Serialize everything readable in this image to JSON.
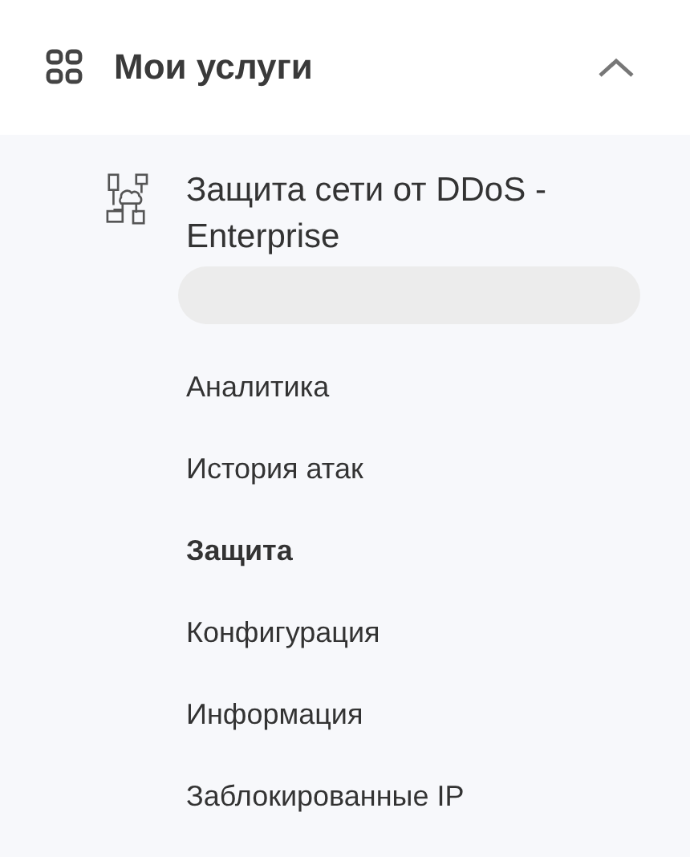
{
  "section": {
    "title": "Мои услуги",
    "expanded": true
  },
  "service": {
    "name": "Защита сети от DDoS - Enterprise"
  },
  "items": [
    {
      "label": "Аналитика",
      "selected": false
    },
    {
      "label": "История атак",
      "selected": false
    },
    {
      "label": "Защита",
      "selected": true
    },
    {
      "label": "Конфигурация",
      "selected": false
    },
    {
      "label": "Информация",
      "selected": false
    },
    {
      "label": "Заблокированные IP",
      "selected": false
    }
  ]
}
